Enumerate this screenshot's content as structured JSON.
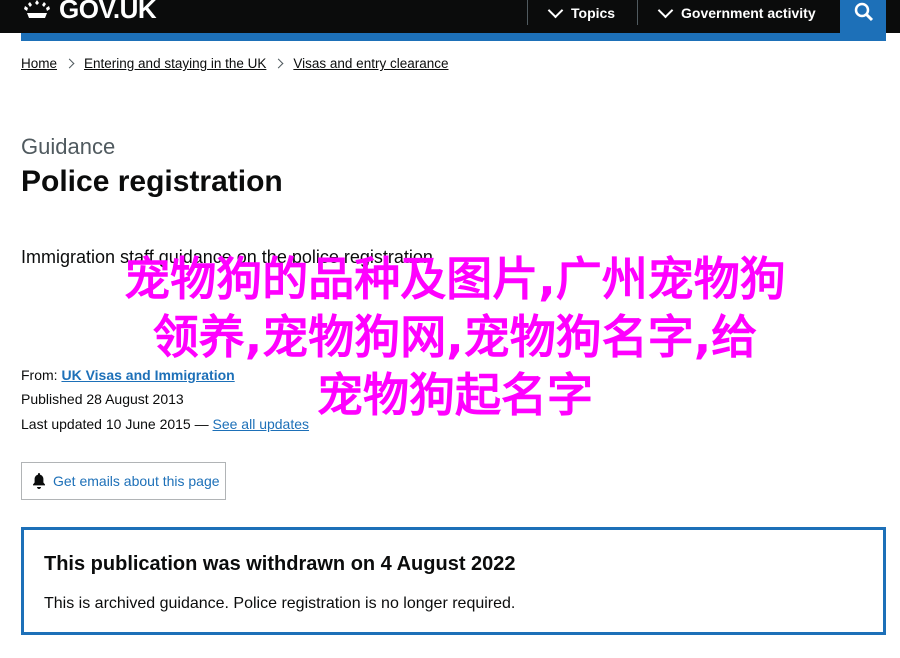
{
  "header": {
    "logo_text": "GOV.UK",
    "menu_topics": "Topics",
    "menu_government": "Government activity",
    "search_icon": "search-icon"
  },
  "breadcrumb": [
    {
      "label": "Home"
    },
    {
      "label": "Entering and staying in the UK"
    },
    {
      "label": "Visas and entry clearance"
    }
  ],
  "caption": "Guidance",
  "title": "Police registration",
  "intro": "Immigration staff guidance on the police registration",
  "overlay_text": [
    "宠物狗的品种及图片,广州宠物狗",
    "领养,宠物狗网,宠物狗名字,给",
    "宠物狗起名字"
  ],
  "meta": {
    "from_label": "From:",
    "from_link": "UK Visas and Immigration",
    "published_label": "Published",
    "published_date": "28 August 2013",
    "updated_label": "Last updated",
    "updated_date": "10 June 2015 —",
    "updates_link": "See all updates"
  },
  "email_button": "Get emails about this page",
  "notice": {
    "title": "This publication was withdrawn on 4 August 2022",
    "body": "This is archived guidance. Police registration is no longer required."
  },
  "colors": {
    "header": "#0b0c0c",
    "brand_blue": "#1d70b8",
    "overlay_magenta": "#ff00ff"
  }
}
